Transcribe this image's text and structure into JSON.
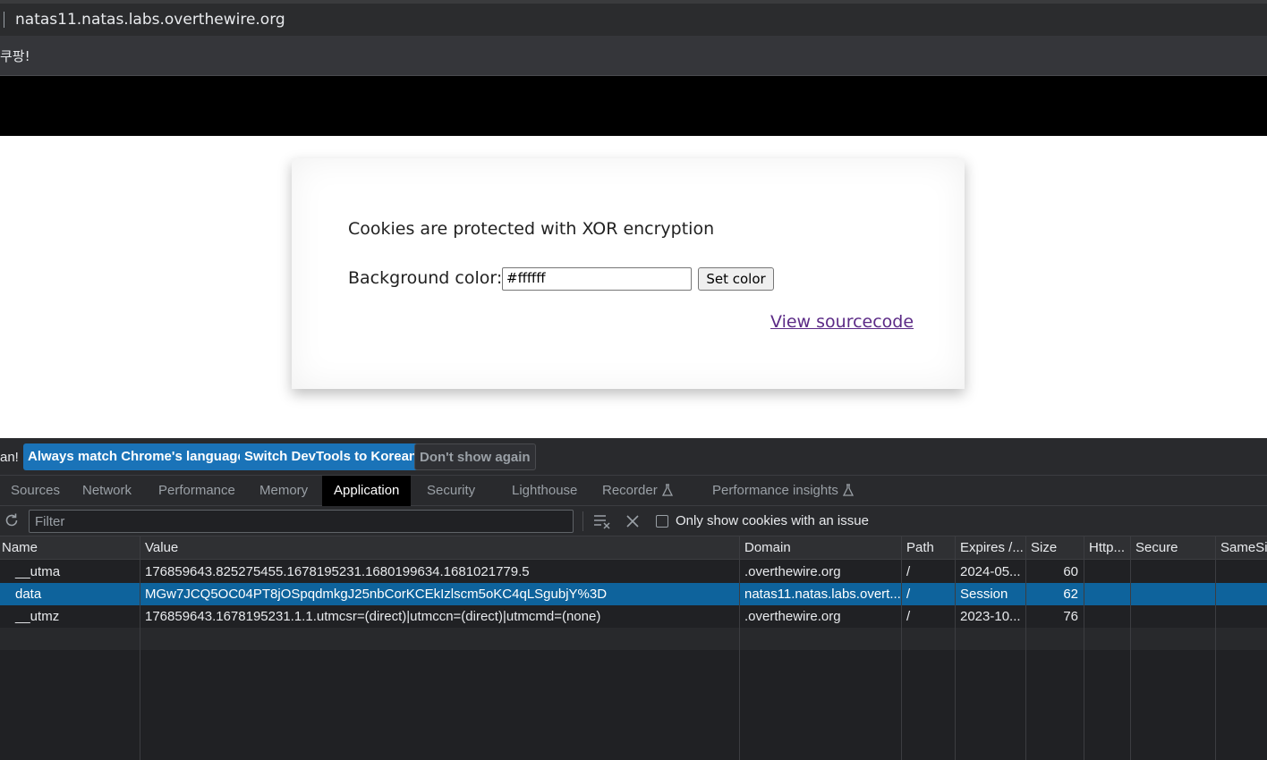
{
  "browser": {
    "url": "natas11.natas.labs.overthewire.org",
    "bookmark": "쿠팡!"
  },
  "page": {
    "heading": "Cookies are protected with XOR encryption",
    "bg_label": "Background color:",
    "bg_value": "#ffffff",
    "set_button": "Set color",
    "source_link": "View sourcecode"
  },
  "devtools": {
    "infobar": {
      "message": "an!",
      "btn_match": "Always match Chrome's language",
      "btn_switch": "Switch DevTools to Korean",
      "btn_dismiss": "Don't show again"
    },
    "tabs": [
      "Sources",
      "Network",
      "Performance",
      "Memory",
      "Application",
      "Security",
      "Lighthouse",
      "Recorder",
      "Performance insights"
    ],
    "active_tab": "Application",
    "filter_placeholder": "Filter",
    "only_issue_label": "Only show cookies with an issue",
    "columns": [
      "Name",
      "Value",
      "Domain",
      "Path",
      "Expires /...",
      "Size",
      "Http...",
      "Secure",
      "SameSit"
    ],
    "cookies": [
      {
        "name": "__utma",
        "value": "176859643.825275455.1678195231.1680199634.1681021779.5",
        "domain": ".overthewire.org",
        "path": "/",
        "expires": "2024-05...",
        "size": "60"
      },
      {
        "name": "data",
        "value": "MGw7JCQ5OC04PT8jOSpqdmkgJ25nbCorKCEkIzlscm5oKC4qLSgubjY%3D",
        "domain": "natas11.natas.labs.overt...",
        "path": "/",
        "expires": "Session",
        "size": "62"
      },
      {
        "name": "__utmz",
        "value": "176859643.1678195231.1.1.utmcsr=(direct)|utmccn=(direct)|utmcmd=(none)",
        "domain": ".overthewire.org",
        "path": "/",
        "expires": "2023-10...",
        "size": "76"
      }
    ],
    "selected_row": 1
  }
}
